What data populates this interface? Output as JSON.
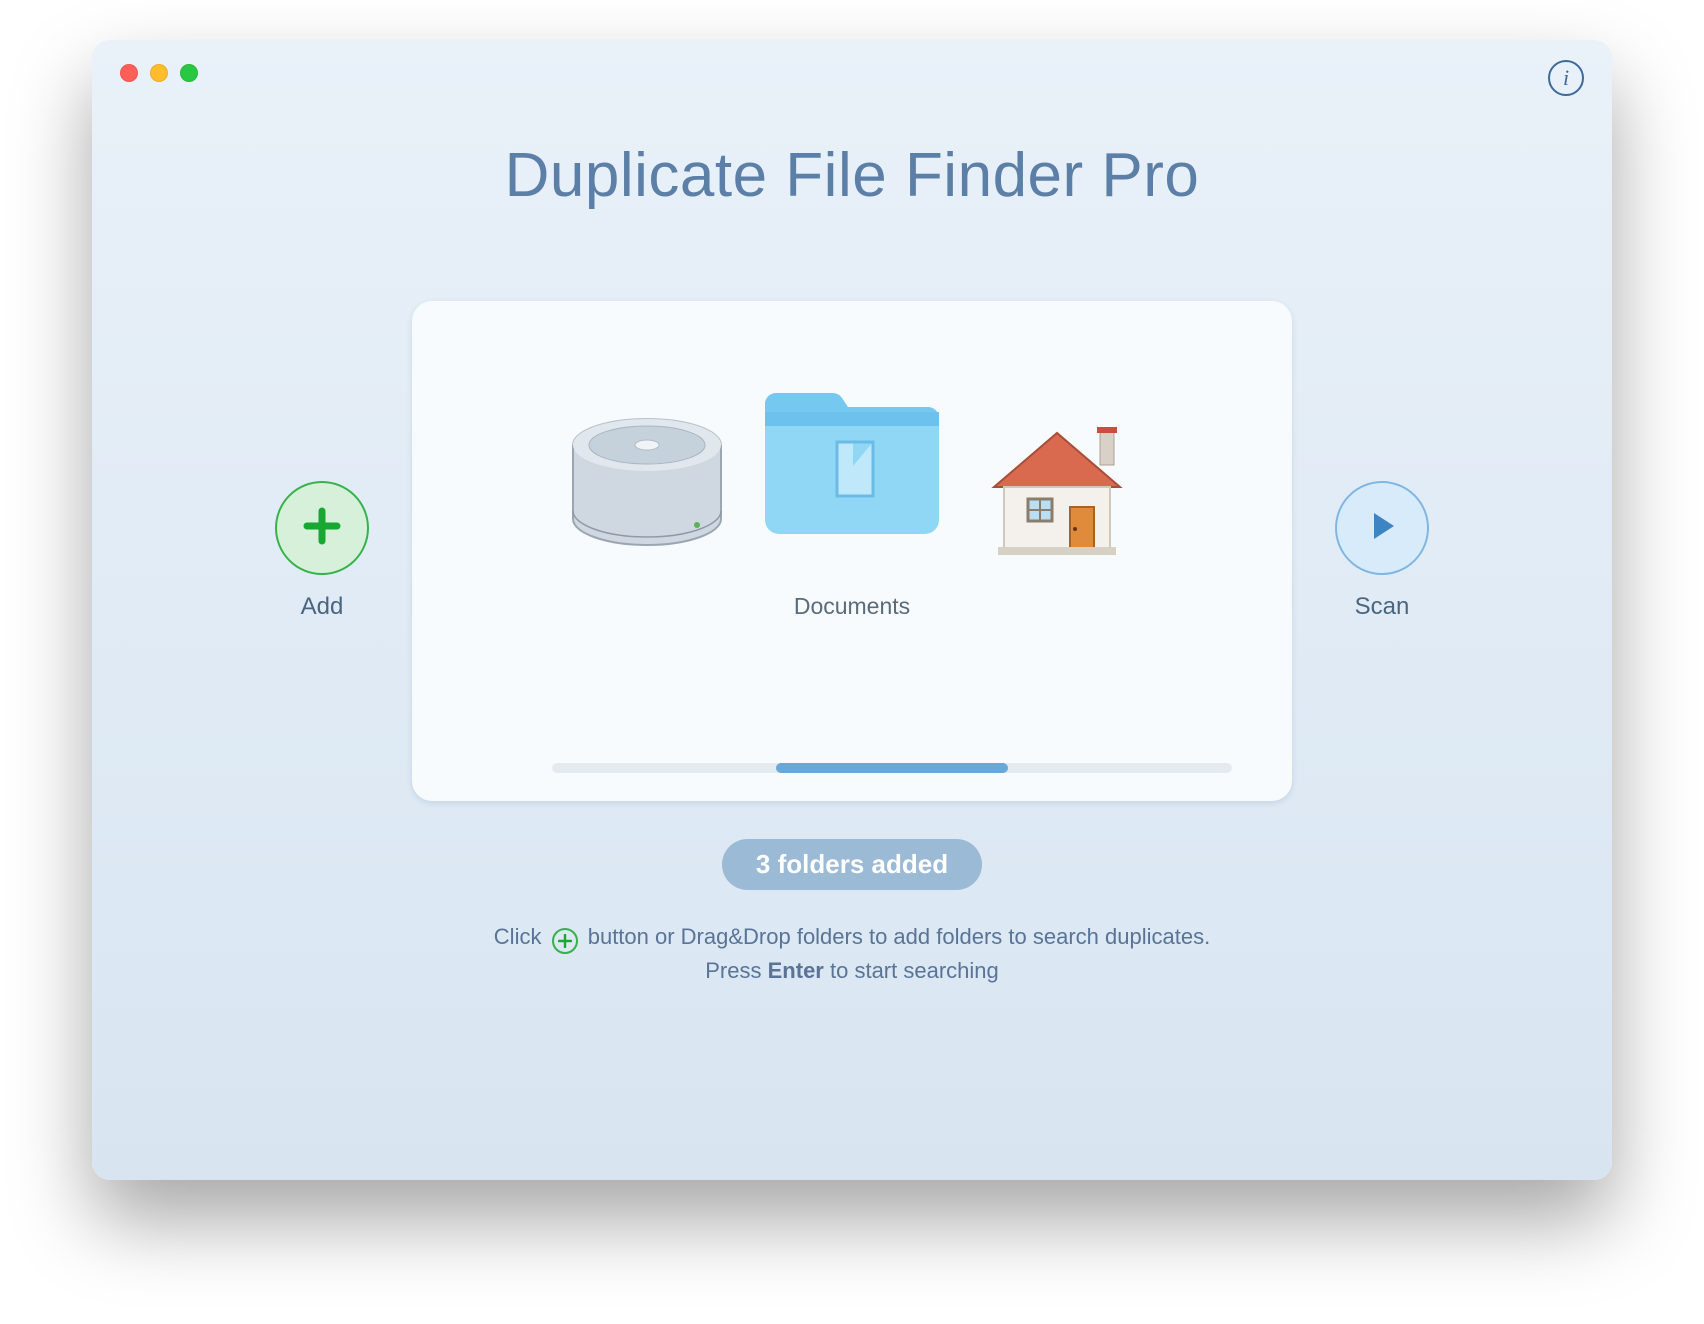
{
  "app": {
    "title": "Duplicate File Finder Pro",
    "info_glyph": "i"
  },
  "buttons": {
    "add_label": "Add",
    "scan_label": "Scan"
  },
  "folders": {
    "selected_label": "Documents",
    "left_icon": "hard-drive",
    "center_icon": "documents-folder",
    "right_icon": "home-folder"
  },
  "status": {
    "badge": "3 folders added"
  },
  "hint": {
    "line1_pre": "Click",
    "line1_post": "button or Drag&Drop folders to add folders to search duplicates.",
    "line2_pre": "Press",
    "line2_bold": "Enter",
    "line2_post": "to start searching"
  }
}
